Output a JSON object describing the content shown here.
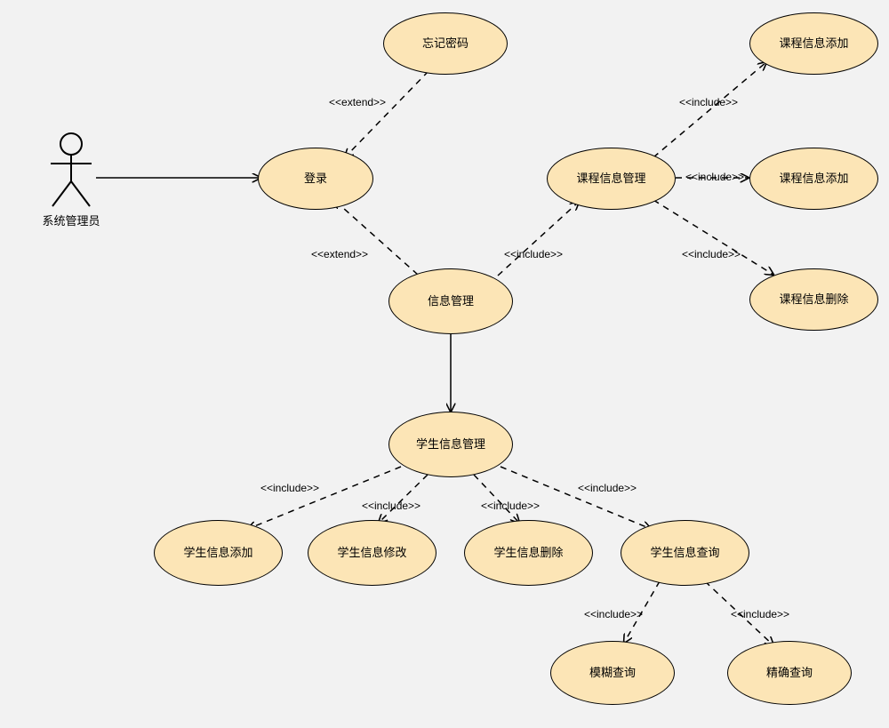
{
  "actor": {
    "label": "系统管理员"
  },
  "usecases": {
    "forgot_pw": "忘记密码",
    "login": "登录",
    "info_mgmt": "信息管理",
    "course_mgmt": "课程信息管理",
    "course_add_top": "课程信息添加",
    "course_add_mid": "课程信息添加",
    "course_del": "课程信息删除",
    "student_mgmt": "学生信息管理",
    "stu_add": "学生信息添加",
    "stu_mod": "学生信息修改",
    "stu_del": "学生信息删除",
    "stu_query": "学生信息查询",
    "fuzzy": "模糊查询",
    "exact": "精确查询"
  },
  "rel": {
    "extend": "<<extend>>",
    "include": "<<include>>"
  }
}
